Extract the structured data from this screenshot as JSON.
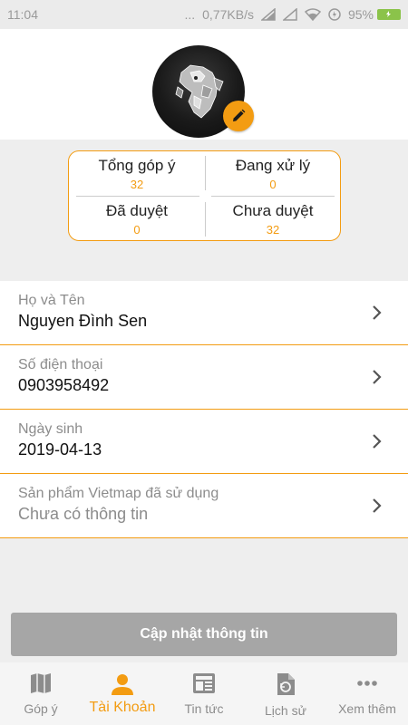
{
  "status_bar": {
    "time": "11:04",
    "dots": "...",
    "network_speed": "0,77KB/s",
    "battery_percent": "95%"
  },
  "profile": {
    "avatar_icon": "lion-icon",
    "edit_icon": "pencil-icon"
  },
  "stats": [
    {
      "label": "Tổng góp ý",
      "value": "32"
    },
    {
      "label": "Đang xử lý",
      "value": "0"
    },
    {
      "label": "Đã duyệt",
      "value": "0"
    },
    {
      "label": "Chưa duyệt",
      "value": "32"
    }
  ],
  "info": [
    {
      "label": "Họ và Tên",
      "value": "Nguyen Đình Sen"
    },
    {
      "label": "Số điện thoại",
      "value": "0903958492"
    },
    {
      "label": "Ngày sinh",
      "value": "2019-04-13"
    },
    {
      "label": "Sản phẩm Vietmap đã sử dụng",
      "value": "Chưa có thông tin"
    }
  ],
  "update_button": "Cập nhật thông tin",
  "nav": [
    {
      "label": "Góp ý",
      "icon": "map-icon"
    },
    {
      "label": "Tài Khoản",
      "icon": "person-icon"
    },
    {
      "label": "Tin tức",
      "icon": "news-icon"
    },
    {
      "label": "Lịch sử",
      "icon": "history-icon"
    },
    {
      "label": "Xem thêm",
      "icon": "more-icon"
    }
  ],
  "colors": {
    "accent": "#f39c12",
    "button_disabled": "#a6a6a6",
    "battery": "#8bc34a"
  }
}
